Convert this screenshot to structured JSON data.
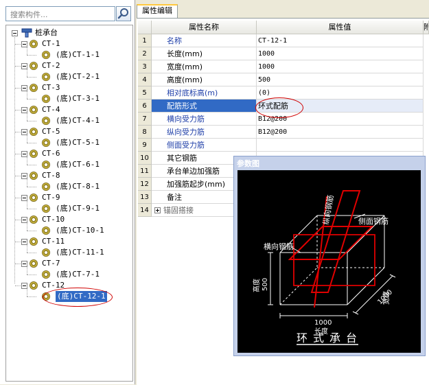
{
  "search": {
    "placeholder": "搜索构件..."
  },
  "tree": {
    "root": "桩承台",
    "groups": [
      {
        "name": "CT-1",
        "child": "(底)CT-1-1"
      },
      {
        "name": "CT-2",
        "child": "(底)CT-2-1"
      },
      {
        "name": "CT-3",
        "child": "(底)CT-3-1"
      },
      {
        "name": "CT-4",
        "child": "(底)CT-4-1"
      },
      {
        "name": "CT-5",
        "child": "(底)CT-5-1"
      },
      {
        "name": "CT-6",
        "child": "(底)CT-6-1"
      },
      {
        "name": "CT-8",
        "child": "(底)CT-8-1"
      },
      {
        "name": "CT-9",
        "child": "(底)CT-9-1"
      },
      {
        "name": "CT-10",
        "child": "(底)CT-10-1"
      },
      {
        "name": "CT-11",
        "child": "(底)CT-11-1"
      },
      {
        "name": "CT-7",
        "child": "(底)CT-7-1"
      },
      {
        "name": "CT-12",
        "child": "(底)CT-12-1"
      }
    ],
    "selected": "(底)CT-12-1"
  },
  "tab": {
    "label": "属性编辑"
  },
  "grid": {
    "headers": {
      "name": "属性名称",
      "value": "属性值",
      "extra": "附"
    },
    "rows": [
      {
        "num": "1",
        "name": "名称",
        "value": "CT-12-1",
        "style": "blue"
      },
      {
        "num": "2",
        "name": "长度(mm)",
        "value": "1000",
        "style": ""
      },
      {
        "num": "3",
        "name": "宽度(mm)",
        "value": "1000",
        "style": ""
      },
      {
        "num": "4",
        "name": "高度(mm)",
        "value": "500",
        "style": ""
      },
      {
        "num": "5",
        "name": "相对底标高(m)",
        "value": "(0)",
        "style": "blue"
      },
      {
        "num": "6",
        "name": "配筋形式",
        "value": "环式配筋",
        "style": "blue"
      },
      {
        "num": "7",
        "name": "横向受力筋",
        "value": "B12@200",
        "style": "blue"
      },
      {
        "num": "8",
        "name": "纵向受力筋",
        "value": "B12@200",
        "style": "blue"
      },
      {
        "num": "9",
        "name": "侧面受力筋",
        "value": "",
        "style": "blue"
      },
      {
        "num": "10",
        "name": "其它钢筋",
        "value": "",
        "style": ""
      },
      {
        "num": "11",
        "name": "承台单边加强筋",
        "value": "",
        "style": ""
      },
      {
        "num": "12",
        "name": "加强筋起步(mm)",
        "value": "",
        "style": ""
      },
      {
        "num": "13",
        "name": "备注",
        "value": "",
        "style": ""
      },
      {
        "num": "14",
        "name": "锚固搭接",
        "value": "",
        "style": "gray"
      }
    ]
  },
  "dialog": {
    "title": "参数图",
    "labels": {
      "longitudinal": "纵向钢筋",
      "side": "侧面钢筋",
      "transverse": "横向钢筋",
      "height_name": "高度",
      "height_val": "500",
      "length_val": "1000",
      "length_name": "长度",
      "width_val": "1000",
      "width_name": "宽度",
      "caption": "环式承台"
    }
  },
  "colors": {
    "selection": "#316ac5",
    "rebar": "#e00000",
    "annotation": "#d00000"
  }
}
